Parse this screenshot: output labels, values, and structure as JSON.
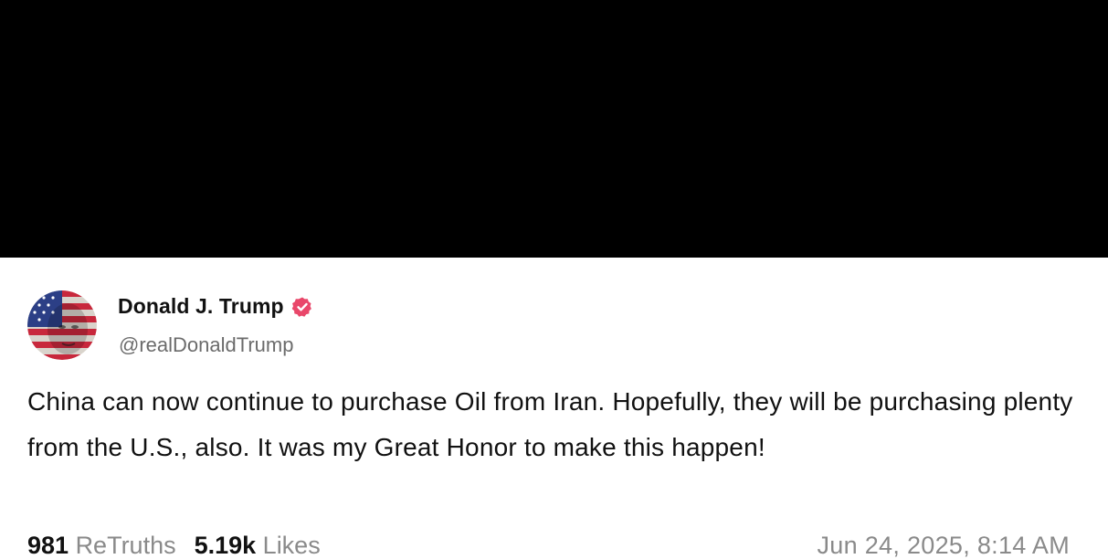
{
  "post": {
    "author": {
      "display_name": "Donald J. Trump",
      "handle": "@realDonaldTrump",
      "verified_icon": "verified-badge-icon",
      "avatar_icon": "avatar-flag-portrait"
    },
    "text": "China can now continue to purchase Oil from Iran. Hopefully, they will be purchasing plenty from the U.S., also. It was my Great Honor to make this happen!",
    "stats": {
      "retruths_count": "981",
      "retruths_label": "ReTruths",
      "likes_count": "5.19k",
      "likes_label": "Likes"
    },
    "timestamp": "Jun 24, 2025, 8:14 AM"
  },
  "colors": {
    "background_band": "#000000",
    "card": "#ffffff",
    "verified": "#e9476a",
    "text_primary": "#111111",
    "text_secondary": "#8a8a8a"
  }
}
